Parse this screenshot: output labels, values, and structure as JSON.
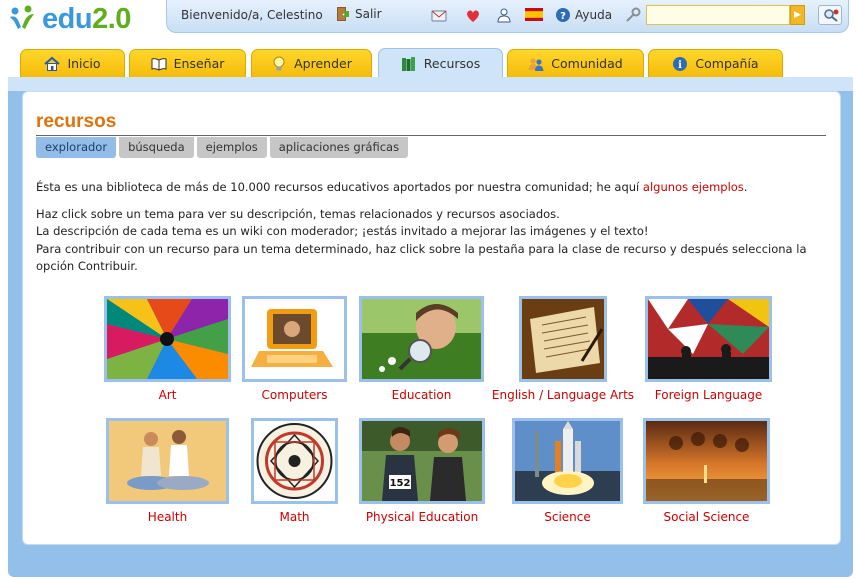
{
  "brand": {
    "name_a": "edu",
    "name_b": "2.0"
  },
  "userbar": {
    "welcome": "Bienvenido/a, Celestino",
    "logout_label": "Salir",
    "help_label": "Ayuda",
    "search_value": "",
    "icons": [
      "mail-icon",
      "heart-icon",
      "user-icon",
      "spain-flag-icon",
      "help-icon",
      "key-icon",
      "search-go-icon",
      "advanced-search-icon"
    ]
  },
  "tabs": [
    {
      "label": "Inicio",
      "icon": "home-icon"
    },
    {
      "label": "Enseñar",
      "icon": "book-icon"
    },
    {
      "label": "Aprender",
      "icon": "lightbulb-icon"
    },
    {
      "label": "Recursos",
      "icon": "books-icon",
      "active": true
    },
    {
      "label": "Comunidad",
      "icon": "people-icon"
    },
    {
      "label": "Compañía",
      "icon": "info-icon"
    }
  ],
  "section": {
    "title": "recursos",
    "subtabs": [
      "explorador",
      "búsqueda",
      "ejemplos",
      "aplicaciones gráficas"
    ],
    "active_subtab": "explorador"
  },
  "intro": {
    "p1_text": "Ésta es una biblioteca de más de 10.000 recursos educativos aportados por nuestra comunidad; he aquí ",
    "p1_link": "algunos ejemplos",
    "p1_end": ".",
    "p2_line1": "Haz click sobre un tema para ver su descripción, temas relacionados y recursos asociados.",
    "p2_line2": "La descripción de cada tema es un wiki con moderador; ¡estás invitado a mejorar las imágenes y el texto!",
    "p2_line3": "Para contribuir con un recurso para un tema determinado, haz click sobre la pestaña para la clase de recurso y después selecciona la opción Contribuir."
  },
  "resources": [
    {
      "label": "Art"
    },
    {
      "label": "Computers"
    },
    {
      "label": "Education"
    },
    {
      "label": "English / Language Arts"
    },
    {
      "label": "Foreign Language"
    },
    {
      "label": "Health"
    },
    {
      "label": "Math"
    },
    {
      "label": "Physical Education",
      "bib": "152"
    },
    {
      "label": "Science"
    },
    {
      "label": "Social Science"
    }
  ],
  "colors": {
    "accent_orange": "#e0720a",
    "link_red": "#cc0000",
    "tab_yellow": "#f5bc0b",
    "frame_blue": "#93c0ea",
    "active_subtab": "#93bce9"
  }
}
